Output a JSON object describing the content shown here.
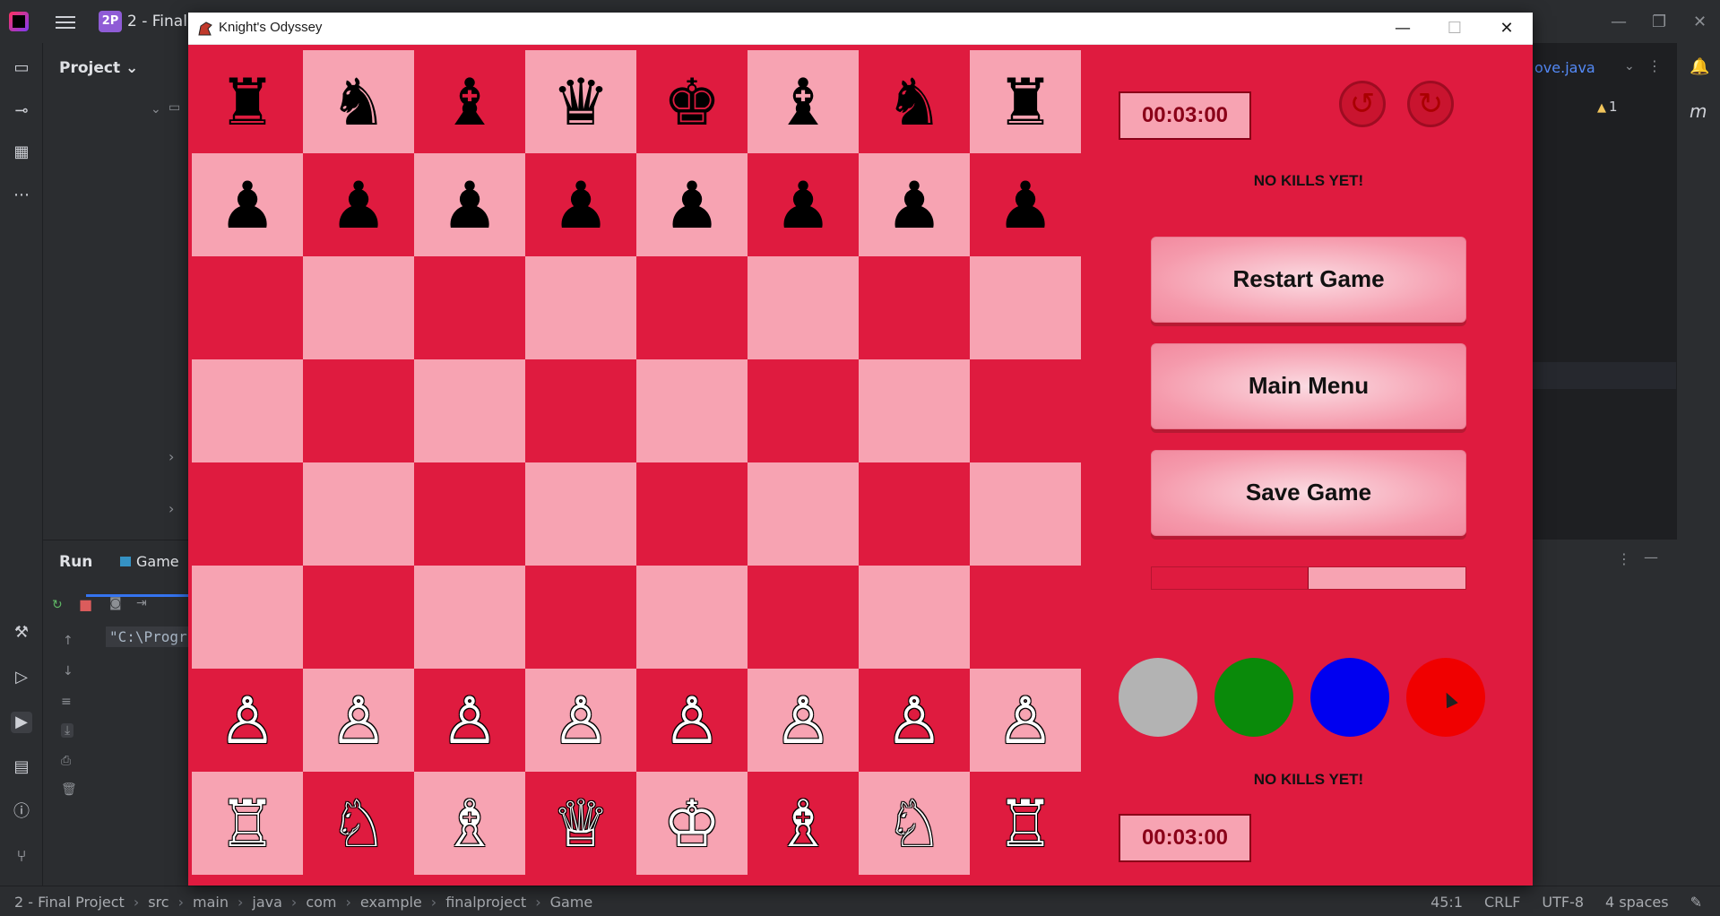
{
  "ide": {
    "project_badge": "2P",
    "project_name": "2 - Final",
    "project_title": "Project ⌄",
    "run_label": "Run",
    "game_tab": "Game",
    "run_output": "\"C:\\Progr",
    "editor_tab": "ove.java",
    "editor_warning": "1",
    "breadcrumbs": [
      "2 - Final Project",
      "src",
      "main",
      "java",
      "com",
      "example",
      "finalproject",
      "Game"
    ],
    "status": {
      "position": "45:1",
      "line_sep": "CRLF",
      "encoding": "UTF-8",
      "indent": "4 spaces"
    }
  },
  "window": {
    "title": "Knight's Odyssey",
    "minimize": "—",
    "maximize": "☐",
    "close": "✕"
  },
  "board": {
    "rows": [
      [
        "♜",
        "♞",
        "♝",
        "♛",
        "♚",
        "♝",
        "♞",
        "♜"
      ],
      [
        "♟",
        "♟",
        "♟",
        "♟",
        "♟",
        "♟",
        "♟",
        "♟"
      ],
      [
        "",
        "",
        "",
        "",
        "",
        "",
        "",
        ""
      ],
      [
        "",
        "",
        "",
        "",
        "",
        "",
        "",
        ""
      ],
      [
        "",
        "",
        "",
        "",
        "",
        "",
        "",
        ""
      ],
      [
        "",
        "",
        "",
        "",
        "",
        "",
        "",
        ""
      ],
      [
        "♙",
        "♙",
        "♙",
        "♙",
        "♙",
        "♙",
        "♙",
        "♙"
      ],
      [
        "♖",
        "♘",
        "♗",
        "♕",
        "♔",
        "♗",
        "♘",
        "♖"
      ]
    ],
    "colors": {
      "light": "#f7a3b2",
      "dark": "#df1b3f"
    }
  },
  "panel": {
    "top_timer": "00:03:00",
    "bottom_timer": "00:03:00",
    "undo_icon": "undo-icon",
    "redo_icon": "redo-icon",
    "top_kills": "NO KILLS YET!",
    "bottom_kills": "NO KILLS YET!",
    "restart_label": "Restart Game",
    "main_menu_label": "Main Menu",
    "save_label": "Save Game",
    "progress_fraction": 0.5,
    "swatches": [
      "#b3b3b3",
      "#0a8a0a",
      "#0000f0",
      "#f00000"
    ]
  }
}
